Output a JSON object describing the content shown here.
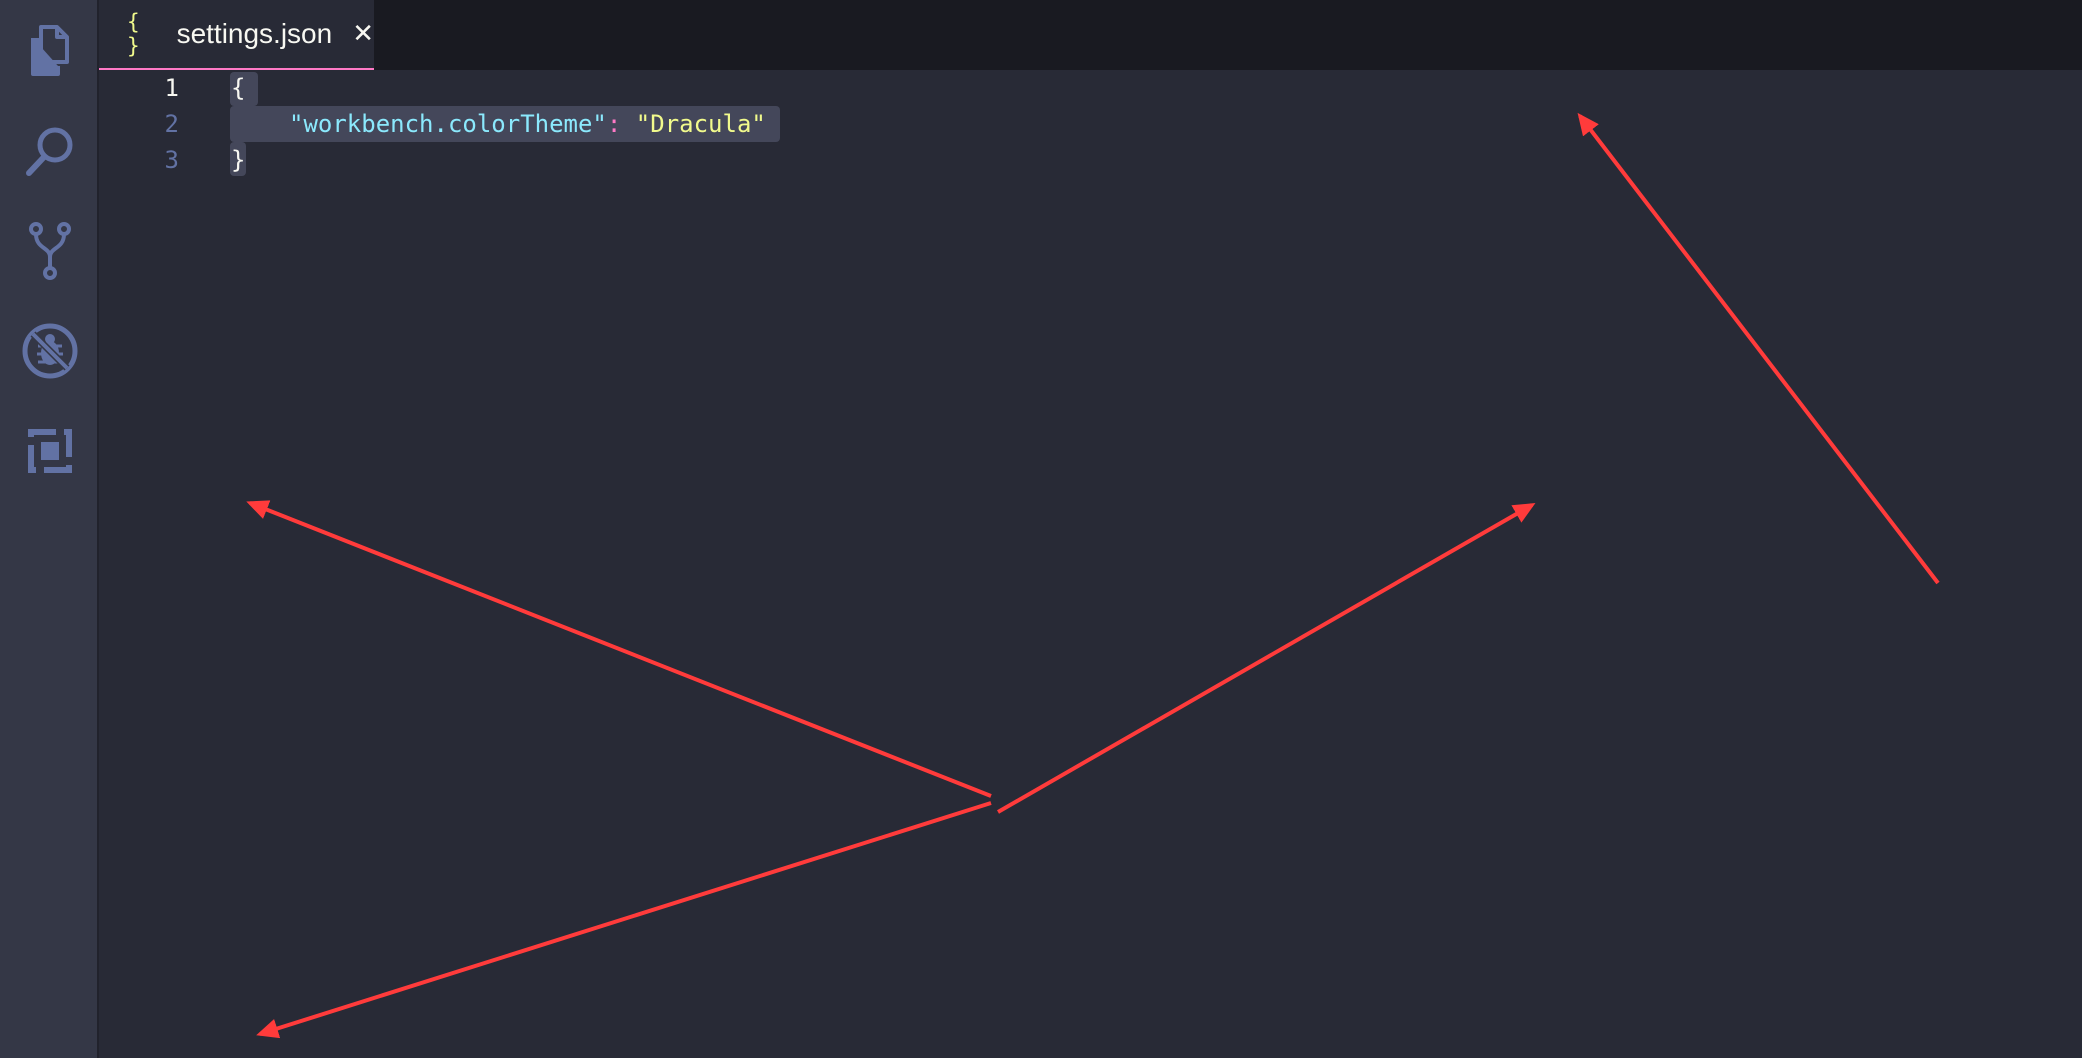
{
  "activity_bar": {
    "items": [
      {
        "name": "explorer",
        "icon": "files-icon"
      },
      {
        "name": "search",
        "icon": "search-icon"
      },
      {
        "name": "source-control",
        "icon": "source-control-icon"
      },
      {
        "name": "debug",
        "icon": "debug-icon"
      },
      {
        "name": "extensions",
        "icon": "extensions-icon"
      }
    ]
  },
  "tabs": [
    {
      "icon_glyph": "{ }",
      "label": "settings.json",
      "close_glyph": "✕",
      "active": true
    }
  ],
  "editor": {
    "lines": [
      {
        "number": "1",
        "text": "{"
      },
      {
        "number": "2",
        "key": "\"workbench.colorTheme\"",
        "colon": ":",
        "value": "\"Dracula\""
      },
      {
        "number": "3",
        "text": "}"
      }
    ]
  },
  "colors": {
    "background": "#282a36",
    "activity_bar": "#343746",
    "tab_bar": "#191a21",
    "selection": "#44475a",
    "accent_pink": "#ff79c6",
    "key_cyan": "#8be9fd",
    "string_yellow": "#f1fa8c",
    "line_number": "#6272a4",
    "annotation_arrow": "#ff3b3b"
  }
}
